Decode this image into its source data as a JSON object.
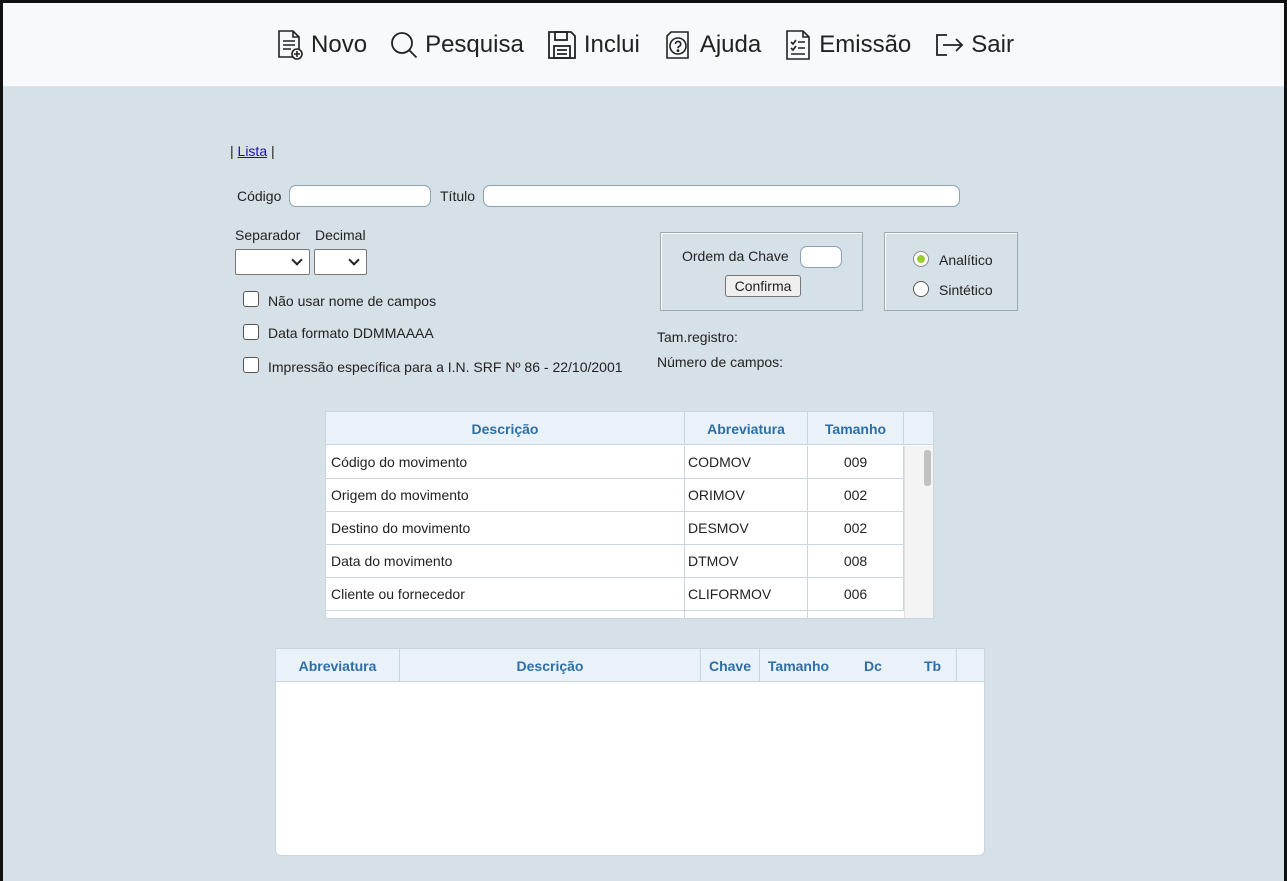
{
  "toolbar": {
    "novo": "Novo",
    "pesquisa": "Pesquisa",
    "inclui": "Inclui",
    "ajuda": "Ajuda",
    "emissao": "Emissão",
    "sair": "Sair"
  },
  "nav": {
    "sep_left": "|",
    "lista": "Lista",
    "sep_right": "|"
  },
  "form": {
    "codigo_label": "Código",
    "codigo_value": "",
    "titulo_label": "Título",
    "titulo_value": "",
    "separador_label": "Separador",
    "decimal_label": "Decimal",
    "separador_value": "",
    "decimal_value": "",
    "checkbox_nao_usar": "Não usar nome de campos",
    "checkbox_data_formato": "Data formato DDMMAAAA",
    "checkbox_impressao": "Impressão específica para a I.N. SRF Nº 86 - 22/10/2001",
    "ordem_chave_label": "Ordem da Chave",
    "ordem_chave_value": "",
    "confirma_label": "Confirma",
    "analitico_label": "Analítico",
    "sintetico_label": "Sintético",
    "tam_registro_label": "Tam.registro:",
    "numero_campos_label": "Número de campos:"
  },
  "fields_table": {
    "headers": {
      "descricao": "Descrição",
      "abreviatura": "Abreviatura",
      "tamanho": "Tamanho"
    },
    "rows": [
      {
        "descricao": "Código do movimento",
        "abreviatura": "CODMOV",
        "tamanho": "009"
      },
      {
        "descricao": "Origem do movimento",
        "abreviatura": "ORIMOV",
        "tamanho": "002"
      },
      {
        "descricao": "Destino do movimento",
        "abreviatura": "DESMOV",
        "tamanho": "002"
      },
      {
        "descricao": "Data do movimento",
        "abreviatura": "DTMOV",
        "tamanho": "008"
      },
      {
        "descricao": "Cliente ou fornecedor",
        "abreviatura": "CLIFORMOV",
        "tamanho": "006"
      }
    ]
  },
  "selected_table": {
    "headers": {
      "abreviatura": "Abreviatura",
      "descricao": "Descrição",
      "chave": "Chave",
      "tamanho": "Tamanho",
      "dc": "Dc",
      "tb": "Tb"
    }
  }
}
